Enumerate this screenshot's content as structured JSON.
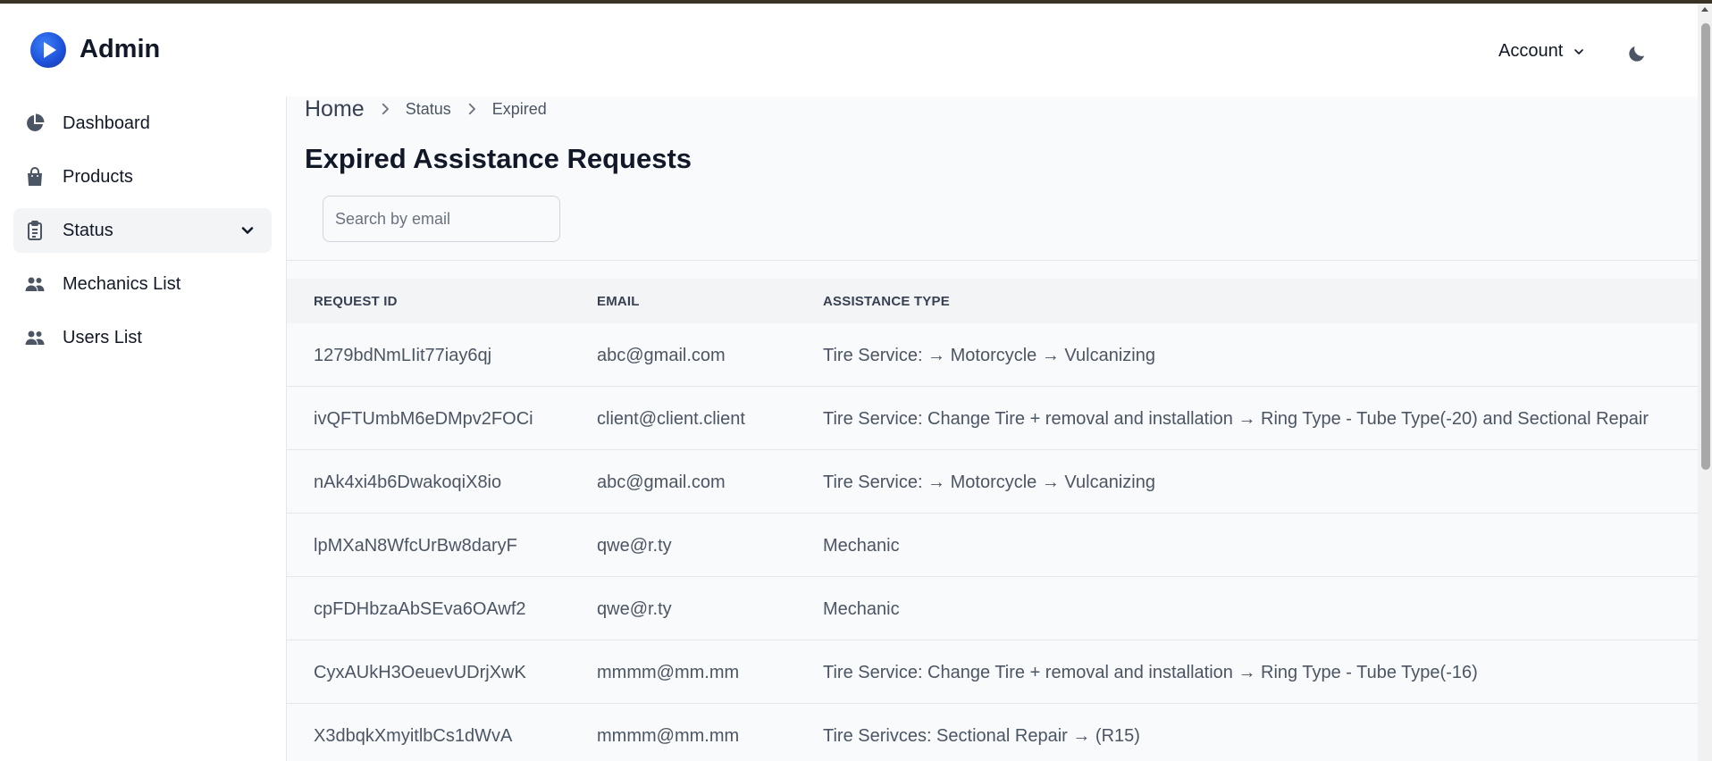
{
  "header": {
    "brand": "Admin",
    "account_label": "Account"
  },
  "sidebar": {
    "items": [
      {
        "label": "Dashboard",
        "icon": "pie-chart-icon"
      },
      {
        "label": "Products",
        "icon": "shopping-bag-icon"
      },
      {
        "label": "Status",
        "icon": "clipboard-icon",
        "active": true
      },
      {
        "label": "Mechanics List",
        "icon": "users-icon"
      },
      {
        "label": "Users List",
        "icon": "users-icon"
      }
    ]
  },
  "breadcrumb": {
    "home": "Home",
    "status": "Status",
    "current": "Expired"
  },
  "main": {
    "title": "Expired Assistance Requests",
    "search_placeholder": "Search by email"
  },
  "table": {
    "headers": [
      "Request ID",
      "Email",
      "Assistance Type"
    ],
    "rows": [
      {
        "id": "1279bdNmLIit77iay6qj",
        "email": "abc@gmail.com",
        "type": "Tire Service: → Motorcycle → Vulcanizing"
      },
      {
        "id": "ivQFTUmbM6eDMpv2FOCi",
        "email": "client@client.client",
        "type": "Tire Service: Change Tire + removal and installation → Ring Type - Tube Type(-20) and Sectional Repair"
      },
      {
        "id": "nAk4xi4b6DwakoqiX8io",
        "email": "abc@gmail.com",
        "type": "Tire Service: → Motorcycle → Vulcanizing"
      },
      {
        "id": "lpMXaN8WfcUrBw8daryF",
        "email": "qwe@r.ty",
        "type": "Mechanic"
      },
      {
        "id": "cpFDHbzaAbSEva6OAwf2",
        "email": "qwe@r.ty",
        "type": "Mechanic"
      },
      {
        "id": "CyxAUkH3OeuevUDrjXwK",
        "email": "mmmm@mm.mm",
        "type": "Tire Service: Change Tire + removal and installation → Ring Type - Tube Type(-16)"
      },
      {
        "id": "X3dbqkXmyitlbCs1dWvA",
        "email": "mmmm@mm.mm",
        "type": "Tire Serivces: Sectional Repair → (R15)"
      }
    ]
  },
  "colors": {
    "accent": "#1d4ed8",
    "text": "#111827",
    "muted": "#4b5563",
    "main_bg": "#f9fafb"
  }
}
